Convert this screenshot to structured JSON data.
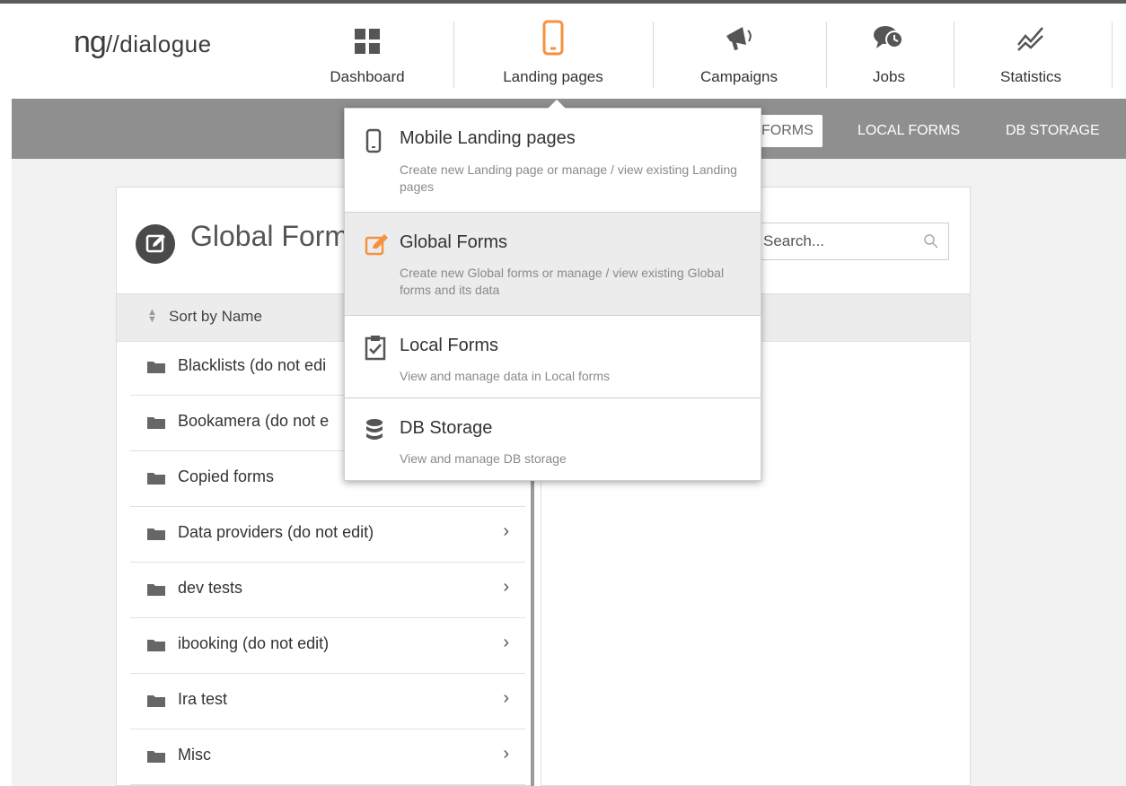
{
  "app": {
    "logo_prefix": "ng",
    "logo_text": "//dialogue"
  },
  "nav": {
    "items": [
      {
        "label": "Dashboard",
        "icon": "dashboard-grid-icon"
      },
      {
        "label": "Landing pages",
        "icon": "mobile-phone-icon",
        "active": true
      },
      {
        "label": "Campaigns",
        "icon": "megaphone-icon"
      },
      {
        "label": "Jobs",
        "icon": "chat-clock-icon"
      },
      {
        "label": "Statistics",
        "icon": "line-chart-icon"
      }
    ]
  },
  "subnav": {
    "tabs": [
      "FORMS",
      "LOCAL FORMS",
      "DB STORAGE"
    ]
  },
  "page": {
    "title": "Global Form",
    "search_placeholder": "Search...",
    "sort_label": "Sort by Name"
  },
  "folders": [
    "Blacklists (do not edi",
    "Bookamera (do not e",
    "Copied forms",
    "Data providers (do not edit)",
    "dev tests",
    "ibooking (do not edit)",
    "Ira test",
    "Misc"
  ],
  "dropdown": {
    "items": [
      {
        "title": "Mobile Landing pages",
        "desc": "Create new Landing page or manage / view existing Landing pages",
        "icon": "mobile-phone-icon"
      },
      {
        "title": "Global Forms",
        "desc": "Create new Global forms or manage / view existing Global forms and its data",
        "icon": "edit-form-icon",
        "highlighted": true
      },
      {
        "title": "Local Forms",
        "desc": "View and manage data in Local forms",
        "icon": "clipboard-check-icon"
      },
      {
        "title": "DB Storage",
        "desc": "View and manage DB storage",
        "icon": "database-icon"
      }
    ]
  },
  "colors": {
    "accent": "#f5923e",
    "subbar": "#8f8f8f",
    "page_bg": "#f2f2f2"
  }
}
